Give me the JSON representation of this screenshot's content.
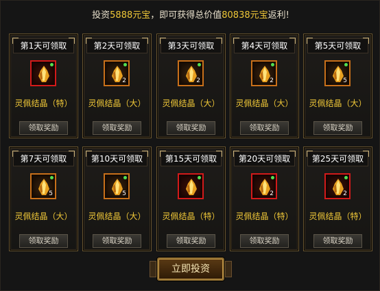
{
  "header": {
    "prefix": "投资",
    "invest_amount": "5888元宝",
    "middle": "，即可获得总价值",
    "total_value": "80838元宝",
    "suffix": "返利!"
  },
  "rewards": [
    {
      "day": "第1天可领取",
      "item": "灵佩结晶（特）",
      "count": "",
      "frame": "red",
      "claim": "领取奖励"
    },
    {
      "day": "第2天可领取",
      "item": "灵佩结晶（大）",
      "count": "2",
      "frame": "orange",
      "claim": "领取奖励"
    },
    {
      "day": "第3天可领取",
      "item": "灵佩结晶（大）",
      "count": "2",
      "frame": "orange",
      "claim": "领取奖励"
    },
    {
      "day": "第4天可领取",
      "item": "灵佩结晶（大）",
      "count": "2",
      "frame": "orange",
      "claim": "领取奖励"
    },
    {
      "day": "第5天可领取",
      "item": "灵佩结晶（大）",
      "count": "5",
      "frame": "orange",
      "claim": "领取奖励"
    },
    {
      "day": "第7天可领取",
      "item": "灵佩结晶（大）",
      "count": "5",
      "frame": "orange",
      "claim": "领取奖励"
    },
    {
      "day": "第10天可领取",
      "item": "灵佩结晶（大）",
      "count": "5",
      "frame": "orange",
      "claim": "领取奖励"
    },
    {
      "day": "第15天可领取",
      "item": "灵佩结晶（特）",
      "count": "",
      "frame": "red",
      "claim": "领取奖励"
    },
    {
      "day": "第20天可领取",
      "item": "灵佩结晶（特）",
      "count": "2",
      "frame": "red",
      "claim": "领取奖励"
    },
    {
      "day": "第25天可领取",
      "item": "灵佩结晶（特）",
      "count": "2",
      "frame": "red",
      "claim": "领取奖励"
    }
  ],
  "invest_button": "立即投资",
  "colors": {
    "highlight": "#f0c838",
    "item_name": "#f0c838",
    "red_frame": "#d41a1a",
    "orange_frame": "#c9701a"
  },
  "icons": {
    "item": "crystal-icon",
    "status": "green-dot-icon"
  }
}
